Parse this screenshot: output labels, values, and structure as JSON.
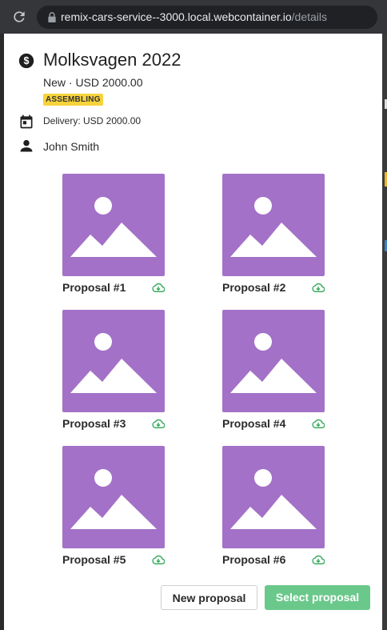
{
  "browser": {
    "url_host": "remix-cars-service--3000.local.webcontainer.io",
    "url_path": "/details"
  },
  "car": {
    "name": "Molksvagen 2022",
    "summary": "New · USD 2000.00",
    "status": "ASSEMBLING",
    "delivery": "Delivery: USD 2000.00",
    "owner": "John Smith"
  },
  "proposals": [
    {
      "label": "Proposal #1"
    },
    {
      "label": "Proposal #2"
    },
    {
      "label": "Proposal #3"
    },
    {
      "label": "Proposal #4"
    },
    {
      "label": "Proposal #5"
    },
    {
      "label": "Proposal #6"
    }
  ],
  "actions": {
    "new_label": "New proposal",
    "select_label": "Select proposal"
  },
  "colors": {
    "thumbnail": "#a371c7",
    "badge": "#f7d33c",
    "download": "#2ea655",
    "select_button": "#6bc88b"
  },
  "icons": {
    "header": "dollar-circle-icon",
    "delivery": "calendar-icon",
    "owner": "person-icon",
    "thumbnail": "image-placeholder-icon",
    "download": "cloud-download-icon"
  }
}
